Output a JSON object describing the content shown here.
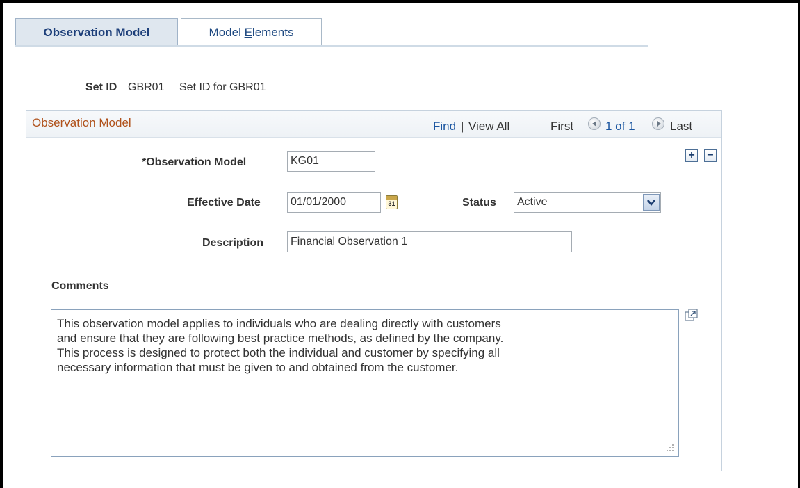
{
  "tabs": [
    {
      "label": "Observation Model",
      "active": true
    },
    {
      "label_prefix": "Model ",
      "label_mnemonic": "E",
      "label_suffix": "lements",
      "active": false
    }
  ],
  "setid": {
    "label": "Set ID",
    "value": "GBR01",
    "description": "Set ID for GBR01"
  },
  "group": {
    "title": "Observation Model",
    "find": "Find",
    "separator": "|",
    "view_all": "View All",
    "first": "First",
    "page_count": "1 of 1",
    "last": "Last"
  },
  "fields": {
    "obs_model_label": "*Observation Model",
    "obs_model_value": "KG01",
    "eff_date_label": "Effective Date",
    "eff_date_value": "01/01/2000",
    "calendar_day": "31",
    "status_label": "Status",
    "status_value": "Active",
    "description_label": "Description",
    "description_value": "Financial Observation 1"
  },
  "comments": {
    "label": "Comments",
    "lines": [
      "This observation model applies to individuals who are dealing directly with customers",
      "and ensure that they are following best practice methods, as defined by the company.",
      "This process is designed to protect both the individual and customer by specifying all",
      "necessary information that must be given to and obtained from the customer."
    ]
  },
  "colors": {
    "group_title": "#b0521c",
    "link": "#1a55a0",
    "tab_active_bg": "#dfe7ef"
  }
}
